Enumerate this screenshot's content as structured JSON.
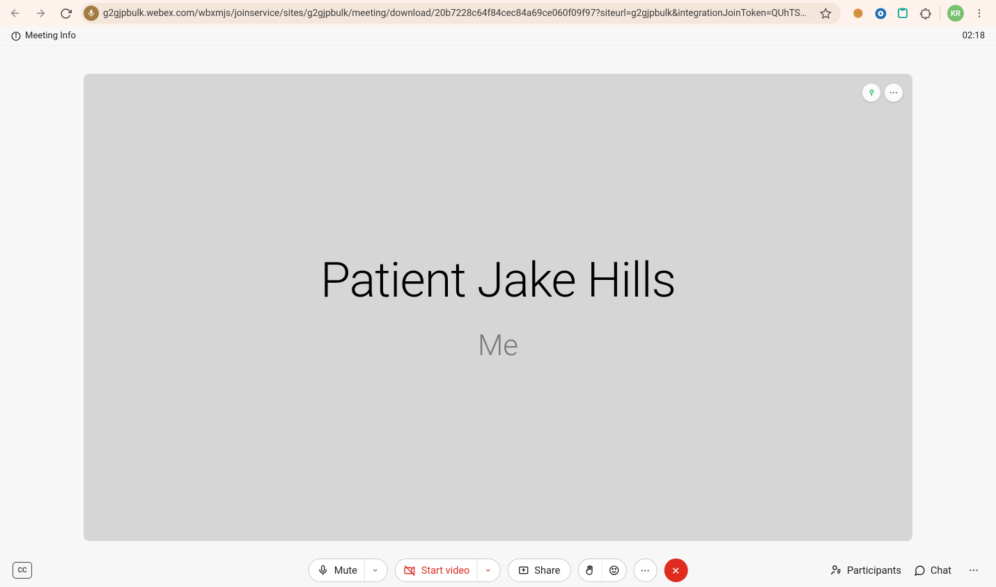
{
  "browser": {
    "url": "g2gjpbulk.webex.com/wbxmjs/joinservice/sites/g2gjpbulk/meeting/download/20b7228c64f84cec84a69ce060f09f97?siteurl=g2gjpbulk&integrationJoinToken=QUhTSwAAAAfmljtI%2...",
    "avatar_initials": "KR"
  },
  "header": {
    "meeting_info_label": "Meeting Info",
    "timer": "02:18"
  },
  "video": {
    "participant_name": "Patient Jake Hills",
    "self_label": "Me"
  },
  "controls": {
    "cc_label": "CC",
    "mute_label": "Mute",
    "start_video_label": "Start video",
    "share_label": "Share",
    "participants_label": "Participants",
    "chat_label": "Chat"
  }
}
